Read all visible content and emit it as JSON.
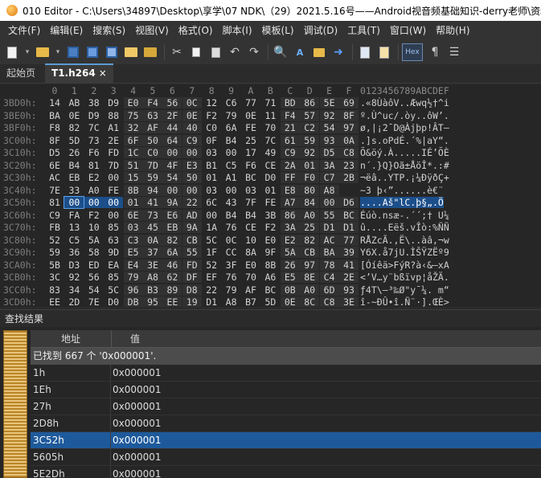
{
  "window": {
    "title": "010 Editor - C:\\Users\\34897\\Desktop\\享学\\07 NDK\\（29）2021.5.16号——Android视音频基础知识-derry老师\\资料"
  },
  "menu": [
    "文件(F)",
    "编辑(E)",
    "搜索(S)",
    "视图(V)",
    "格式(O)",
    "脚本(I)",
    "模板(L)",
    "调试(D)",
    "工具(T)",
    "窗口(W)",
    "帮助(H)"
  ],
  "toolbar": {
    "icons": [
      "new-file-icon",
      "open-folder-icon",
      "save-icon",
      "save-as-icon",
      "save-all-icon",
      "open-project-icon",
      "save-project-icon",
      "cut-icon",
      "copy-icon",
      "paste-icon",
      "undo-icon",
      "redo-icon",
      "find-icon",
      "replace-icon",
      "find-in-files-icon",
      "goto-icon",
      "run-script-icon",
      "run-template-icon",
      "hex-mode-icon",
      "show-whitespace-icon",
      "word-wrap-icon"
    ],
    "hex_label": "Hex"
  },
  "tabs": [
    {
      "label": "起始页",
      "active": false
    },
    {
      "label": "T1.h264",
      "active": true,
      "close": "×"
    }
  ],
  "hex": {
    "header_cols": [
      "0",
      "1",
      "2",
      "3",
      "4",
      "5",
      "6",
      "7",
      "8",
      "9",
      "A",
      "B",
      "C",
      "D",
      "E",
      "F"
    ],
    "header_ascii": "0123456789ABCDEF",
    "rows": [
      {
        "addr": "3BD0h:",
        "bytes": [
          "14",
          "AB",
          "38",
          "D9",
          "E0",
          "F4",
          "56",
          "0C",
          "12",
          "C6",
          "77",
          "71",
          "BD",
          "86",
          "5E",
          "69"
        ],
        "ascii": ".«8ÙàôV..Æwq½†^i"
      },
      {
        "addr": "3BE0h:",
        "bytes": [
          "BA",
          "0E",
          "D9",
          "88",
          "75",
          "63",
          "2F",
          "0E",
          "F2",
          "79",
          "0E",
          "11",
          "F4",
          "57",
          "92",
          "8F"
        ],
        "ascii": "º.Ù^uc/.òy..ôW’."
      },
      {
        "addr": "3BF0h:",
        "bytes": [
          "F8",
          "82",
          "7C",
          "A1",
          "32",
          "AF",
          "44",
          "40",
          "C0",
          "6A",
          "FE",
          "70",
          "21",
          "C2",
          "54",
          "97"
        ],
        "ascii": "ø‚|¡2¯D@Àjþp!ÂT—"
      },
      {
        "addr": "3C00h:",
        "bytes": [
          "8F",
          "5D",
          "73",
          "2E",
          "6F",
          "50",
          "64",
          "C9",
          "0F",
          "B4",
          "25",
          "7C",
          "61",
          "59",
          "93",
          "0A"
        ],
        "ascii": ".]s.oPdÉ.´%|aY“."
      },
      {
        "addr": "3C10h:",
        "bytes": [
          "D5",
          "26",
          "F6",
          "FD",
          "1C",
          "C0",
          "00",
          "00",
          "03",
          "00",
          "17",
          "49",
          "C9",
          "92",
          "D5",
          "C8"
        ],
        "ascii": "Õ&öý.À.....IÉ’ÕÈ"
      },
      {
        "addr": "3C20h:",
        "bytes": [
          "6E",
          "B4",
          "81",
          "7D",
          "51",
          "7D",
          "4F",
          "E3",
          "B1",
          "C5",
          "F6",
          "CE",
          "2A",
          "01",
          "3A",
          "23"
        ],
        "ascii": "n´.}Q}Oã±ÅöÎ*.:#"
      },
      {
        "addr": "3C30h:",
        "bytes": [
          "AC",
          "EB",
          "E2",
          "00",
          "15",
          "59",
          "54",
          "50",
          "01",
          "A1",
          "BC",
          "D0",
          "FF",
          "F0",
          "C7",
          "2B"
        ],
        "ascii": "¬ëâ..YTP.¡¼ÐÿðÇ+"
      },
      {
        "addr": "3C40h:",
        "bytes": [
          "7E",
          "33",
          "A0",
          "FE",
          "8B",
          "94",
          "00",
          "00",
          "03",
          "00",
          "03",
          "01",
          "E8",
          "80",
          "A8"
        ],
        "ascii": "~3 þ‹”......è€¨"
      },
      {
        "addr": "3C50h:",
        "bytes": [
          "81",
          "00",
          "00",
          "00",
          "01",
          "41",
          "9A",
          "22",
          "6C",
          "43",
          "7F",
          "FE",
          "A7",
          "84",
          "00",
          "D6"
        ],
        "ascii": "....Aš\"lC.þ§„.Ö"
      },
      {
        "addr": "3C60h:",
        "bytes": [
          "C9",
          "FA",
          "F2",
          "00",
          "6E",
          "73",
          "E6",
          "AD",
          "00",
          "B4",
          "B4",
          "3B",
          "86",
          "A0",
          "55",
          "BC"
        ],
        "ascii": "Éúò.nsæ-.´´;† U¼"
      },
      {
        "addr": "3C70h:",
        "bytes": [
          "FB",
          "13",
          "10",
          "85",
          "03",
          "45",
          "EB",
          "9A",
          "1A",
          "76",
          "CE",
          "F2",
          "3A",
          "25",
          "D1",
          "D1"
        ],
        "ascii": "û....Eëš.vÎò:%ÑÑ"
      },
      {
        "addr": "3C80h:",
        "bytes": [
          "52",
          "C5",
          "5A",
          "63",
          "C3",
          "0A",
          "82",
          "CB",
          "5C",
          "0C",
          "10",
          "E0",
          "E2",
          "82",
          "AC",
          "77"
        ],
        "ascii": "RÅZcÃ.‚Ë\\..àâ‚¬w"
      },
      {
        "addr": "3C90h:",
        "bytes": [
          "59",
          "36",
          "58",
          "9D",
          "E5",
          "37",
          "6A",
          "55",
          "1F",
          "CC",
          "8A",
          "9F",
          "5A",
          "CB",
          "BA",
          "39"
        ],
        "ascii": "Y6X.å7jU.ÌŠŸZËº9"
      },
      {
        "addr": "3CA0h:",
        "bytes": [
          "5B",
          "D3",
          "ED",
          "EA",
          "E4",
          "3E",
          "46",
          "FD",
          "52",
          "3F",
          "E0",
          "8B",
          "26",
          "97",
          "78",
          "41"
        ],
        "ascii": "[Óíêä>FýR?à‹&—xA"
      },
      {
        "addr": "3CB0h:",
        "bytes": [
          "3C",
          "92",
          "56",
          "85",
          "79",
          "A8",
          "62",
          "DF",
          "EF",
          "76",
          "70",
          "A6",
          "E5",
          "8E",
          "C4",
          "2E"
        ],
        "ascii": "<’V…y¨bßïvp¦åŽÄ."
      },
      {
        "addr": "3CC0h:",
        "bytes": [
          "83",
          "34",
          "54",
          "5C",
          "96",
          "B3",
          "89",
          "D8",
          "22",
          "79",
          "AF",
          "BC",
          "0B",
          "A0",
          "6D",
          "93"
        ],
        "ascii": "ƒ4T\\–³‰Ø\"y¯¼. m“"
      },
      {
        "addr": "3CD0h:",
        "bytes": [
          "EE",
          "2D",
          "7E",
          "D0",
          "DB",
          "95",
          "EE",
          "19",
          "D1",
          "A8",
          "B7",
          "5D",
          "0E",
          "8C",
          "C8",
          "3E"
        ],
        "ascii": "î-~ÐÛ•î.Ñ¨·].ŒÈ>"
      },
      {
        "addr": "3CE0h:",
        "bytes": [
          "AA",
          "CC",
          "34",
          "00",
          "04",
          "03",
          "CC",
          "57",
          "C7",
          "47",
          "4A",
          "DD",
          "20",
          "00",
          "AA",
          "AB"
        ],
        "ascii": "ªÌ4...ÌWÇGJÝ .ª«"
      }
    ]
  },
  "results": {
    "title": "查找结果",
    "col_address": "地址",
    "col_value": "值",
    "summary": "已找到 667 个 '0x000001'.",
    "rows": [
      {
        "address": "1h",
        "value": "0x000001"
      },
      {
        "address": "1Eh",
        "value": "0x000001"
      },
      {
        "address": "27h",
        "value": "0x000001"
      },
      {
        "address": "2D8h",
        "value": "0x000001"
      },
      {
        "address": "3C52h",
        "value": "0x000001"
      },
      {
        "address": "5605h",
        "value": "0x000001"
      },
      {
        "address": "5E2Dh",
        "value": "0x000001"
      }
    ],
    "selected_index": 4
  },
  "colors": {
    "selection": "#1c4f8a",
    "selected_row": "#1e5a9b",
    "background": "#262626"
  }
}
